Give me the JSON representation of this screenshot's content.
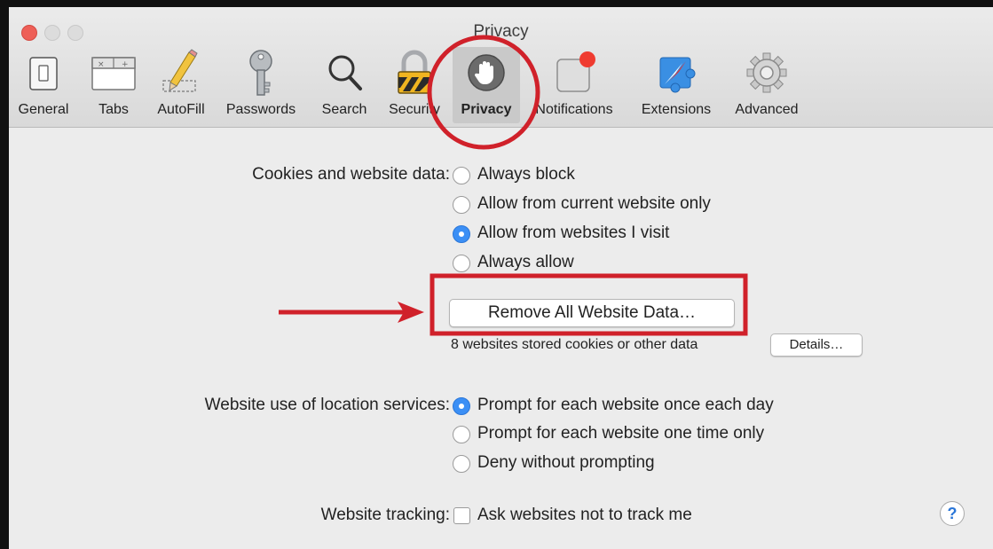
{
  "window": {
    "title": "Privacy"
  },
  "toolbar": {
    "items": [
      {
        "label": "General",
        "icon": "general-switch-icon"
      },
      {
        "label": "Tabs",
        "icon": "tabs-icon"
      },
      {
        "label": "AutoFill",
        "icon": "pencil-icon"
      },
      {
        "label": "Passwords",
        "icon": "key-icon"
      },
      {
        "label": "Search",
        "icon": "magnifier-icon"
      },
      {
        "label": "Security",
        "icon": "padlock-icon"
      },
      {
        "label": "Privacy",
        "icon": "hand-icon",
        "selected": true
      },
      {
        "label": "Notifications",
        "icon": "notification-badge-icon"
      },
      {
        "label": "Extensions",
        "icon": "puzzle-compass-icon"
      },
      {
        "label": "Advanced",
        "icon": "gear-icon"
      }
    ]
  },
  "cookies": {
    "label": "Cookies and website data:",
    "options": [
      {
        "label": "Always block",
        "checked": false
      },
      {
        "label": "Allow from current website only",
        "checked": false
      },
      {
        "label": "Allow from websites I visit",
        "checked": true
      },
      {
        "label": "Always allow",
        "checked": false
      }
    ],
    "remove_button": "Remove All Website Data…",
    "stored_text": "8 websites stored cookies or other data",
    "details_button": "Details…"
  },
  "location": {
    "label": "Website use of location services:",
    "options": [
      {
        "label": "Prompt for each website once each day",
        "checked": true
      },
      {
        "label": "Prompt for each website one time only",
        "checked": false
      },
      {
        "label": "Deny without prompting",
        "checked": false
      }
    ]
  },
  "tracking": {
    "label": "Website tracking:",
    "checkbox_label": "Ask websites not to track me",
    "checked": false
  },
  "help": {
    "label": "?"
  },
  "annotation": {
    "color": "#d0212a"
  }
}
